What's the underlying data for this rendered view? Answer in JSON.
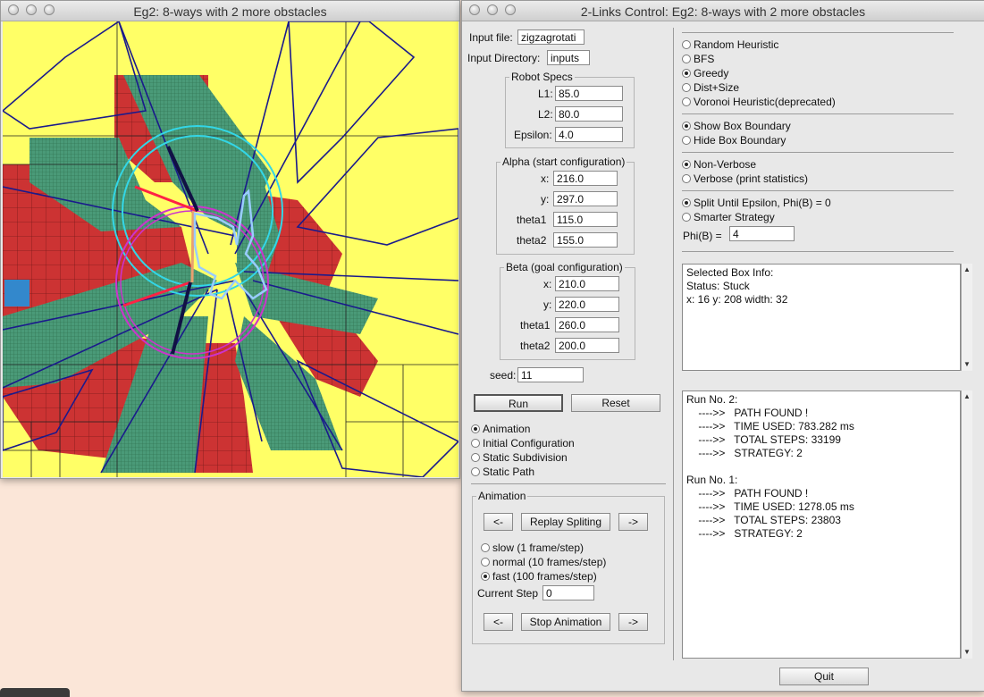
{
  "left_window": {
    "title": "Eg2: 8-ways with 2 more obstacles"
  },
  "right_window": {
    "title": "2-Links Control: Eg2: 8-ways with 2 more obstacles",
    "input_file_label": "Input file:",
    "input_file_value": "zigzagrotati",
    "input_dir_label": "Input Directory:",
    "input_dir_value": "inputs",
    "robot_specs": {
      "title": "Robot Specs",
      "l1_label": "L1:",
      "l1": "85.0",
      "l2_label": "L2:",
      "l2": "80.0",
      "eps_label": "Epsilon:",
      "eps": "4.0"
    },
    "alpha": {
      "title": "Alpha (start configuration)",
      "x_label": "x:",
      "x": "216.0",
      "y_label": "y:",
      "y": "297.0",
      "t1_label": "theta1",
      "t1": "115.0",
      "t2_label": "theta2",
      "t2": "155.0"
    },
    "beta": {
      "title": "Beta (goal configuration)",
      "x_label": "x:",
      "x": "210.0",
      "y_label": "y:",
      "y": "220.0",
      "t1_label": "theta1",
      "t1": "260.0",
      "t2_label": "theta2",
      "t2": "200.0"
    },
    "seed_label": "seed:",
    "seed": "11",
    "run_label": "Run",
    "reset_label": "Reset",
    "view_options": [
      "Animation",
      "Initial Configuration",
      "Static Subdivision",
      "Static Path"
    ],
    "animation_group": {
      "title": "Animation",
      "prev_label": "<-",
      "replay_label": "Replay Spliting",
      "next_label": "->",
      "speeds": [
        "slow (1 frame/step)",
        "normal (10 frames/step)",
        "fast (100 frames/step)"
      ],
      "current_step_label": "Current Step",
      "current_step": "0",
      "prev2_label": "<-",
      "stop_label": "Stop Animation",
      "next2_label": "->"
    },
    "heuristics": [
      "Random Heuristic",
      "BFS",
      "Greedy",
      "Dist+Size",
      "Voronoi Heuristic(deprecated)"
    ],
    "boundary": [
      "Show Box Boundary",
      "Hide Box Boundary"
    ],
    "verbose": [
      "Non-Verbose",
      "Verbose (print statistics)"
    ],
    "split": [
      "Split Until Epsilon, Phi(B) = 0",
      "Smarter Strategy"
    ],
    "phi_label": "Phi(B) =",
    "phi": "4",
    "box_info": "Selected Box Info:\nStatus: Stuck\nx: 16 y: 208 width: 32",
    "run_log": "Run No. 2:\n    ---->>   PATH FOUND !\n    ---->>   TIME USED: 783.282 ms\n    ---->>   TOTAL STEPS: 33199\n    ---->>   STRATEGY: 2\n\nRun No. 1:\n    ---->>   PATH FOUND !\n    ---->>   TIME USED: 1278.05 ms\n    ---->>   TOTAL STEPS: 23803\n    ---->>   STRATEGY: 2",
    "quit_label": "Quit"
  },
  "colors": {
    "free": "#ffff66",
    "blocked": "#cc3333",
    "mixed": "#4a9a78",
    "boundary_line": "#1a1a8c",
    "start_box": "#3388cc",
    "circle_cyan": "#33d6e6",
    "circle_magenta": "#cc33cc",
    "path": "#99ccff"
  }
}
